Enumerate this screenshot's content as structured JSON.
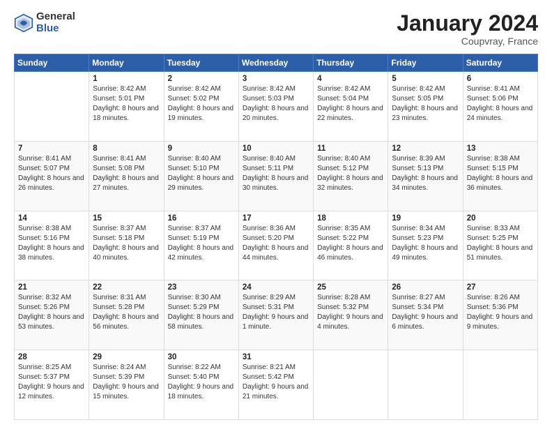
{
  "header": {
    "logo_general": "General",
    "logo_blue": "Blue",
    "title": "January 2024",
    "location": "Coupvray, France"
  },
  "calendar": {
    "days_of_week": [
      "Sunday",
      "Monday",
      "Tuesday",
      "Wednesday",
      "Thursday",
      "Friday",
      "Saturday"
    ],
    "weeks": [
      [
        {
          "day": "",
          "sunrise": "",
          "sunset": "",
          "daylight": ""
        },
        {
          "day": "1",
          "sunrise": "Sunrise: 8:42 AM",
          "sunset": "Sunset: 5:01 PM",
          "daylight": "Daylight: 8 hours and 18 minutes."
        },
        {
          "day": "2",
          "sunrise": "Sunrise: 8:42 AM",
          "sunset": "Sunset: 5:02 PM",
          "daylight": "Daylight: 8 hours and 19 minutes."
        },
        {
          "day": "3",
          "sunrise": "Sunrise: 8:42 AM",
          "sunset": "Sunset: 5:03 PM",
          "daylight": "Daylight: 8 hours and 20 minutes."
        },
        {
          "day": "4",
          "sunrise": "Sunrise: 8:42 AM",
          "sunset": "Sunset: 5:04 PM",
          "daylight": "Daylight: 8 hours and 22 minutes."
        },
        {
          "day": "5",
          "sunrise": "Sunrise: 8:42 AM",
          "sunset": "Sunset: 5:05 PM",
          "daylight": "Daylight: 8 hours and 23 minutes."
        },
        {
          "day": "6",
          "sunrise": "Sunrise: 8:41 AM",
          "sunset": "Sunset: 5:06 PM",
          "daylight": "Daylight: 8 hours and 24 minutes."
        }
      ],
      [
        {
          "day": "7",
          "sunrise": "Sunrise: 8:41 AM",
          "sunset": "Sunset: 5:07 PM",
          "daylight": "Daylight: 8 hours and 26 minutes."
        },
        {
          "day": "8",
          "sunrise": "Sunrise: 8:41 AM",
          "sunset": "Sunset: 5:08 PM",
          "daylight": "Daylight: 8 hours and 27 minutes."
        },
        {
          "day": "9",
          "sunrise": "Sunrise: 8:40 AM",
          "sunset": "Sunset: 5:10 PM",
          "daylight": "Daylight: 8 hours and 29 minutes."
        },
        {
          "day": "10",
          "sunrise": "Sunrise: 8:40 AM",
          "sunset": "Sunset: 5:11 PM",
          "daylight": "Daylight: 8 hours and 30 minutes."
        },
        {
          "day": "11",
          "sunrise": "Sunrise: 8:40 AM",
          "sunset": "Sunset: 5:12 PM",
          "daylight": "Daylight: 8 hours and 32 minutes."
        },
        {
          "day": "12",
          "sunrise": "Sunrise: 8:39 AM",
          "sunset": "Sunset: 5:13 PM",
          "daylight": "Daylight: 8 hours and 34 minutes."
        },
        {
          "day": "13",
          "sunrise": "Sunrise: 8:38 AM",
          "sunset": "Sunset: 5:15 PM",
          "daylight": "Daylight: 8 hours and 36 minutes."
        }
      ],
      [
        {
          "day": "14",
          "sunrise": "Sunrise: 8:38 AM",
          "sunset": "Sunset: 5:16 PM",
          "daylight": "Daylight: 8 hours and 38 minutes."
        },
        {
          "day": "15",
          "sunrise": "Sunrise: 8:37 AM",
          "sunset": "Sunset: 5:18 PM",
          "daylight": "Daylight: 8 hours and 40 minutes."
        },
        {
          "day": "16",
          "sunrise": "Sunrise: 8:37 AM",
          "sunset": "Sunset: 5:19 PM",
          "daylight": "Daylight: 8 hours and 42 minutes."
        },
        {
          "day": "17",
          "sunrise": "Sunrise: 8:36 AM",
          "sunset": "Sunset: 5:20 PM",
          "daylight": "Daylight: 8 hours and 44 minutes."
        },
        {
          "day": "18",
          "sunrise": "Sunrise: 8:35 AM",
          "sunset": "Sunset: 5:22 PM",
          "daylight": "Daylight: 8 hours and 46 minutes."
        },
        {
          "day": "19",
          "sunrise": "Sunrise: 8:34 AM",
          "sunset": "Sunset: 5:23 PM",
          "daylight": "Daylight: 8 hours and 49 minutes."
        },
        {
          "day": "20",
          "sunrise": "Sunrise: 8:33 AM",
          "sunset": "Sunset: 5:25 PM",
          "daylight": "Daylight: 8 hours and 51 minutes."
        }
      ],
      [
        {
          "day": "21",
          "sunrise": "Sunrise: 8:32 AM",
          "sunset": "Sunset: 5:26 PM",
          "daylight": "Daylight: 8 hours and 53 minutes."
        },
        {
          "day": "22",
          "sunrise": "Sunrise: 8:31 AM",
          "sunset": "Sunset: 5:28 PM",
          "daylight": "Daylight: 8 hours and 56 minutes."
        },
        {
          "day": "23",
          "sunrise": "Sunrise: 8:30 AM",
          "sunset": "Sunset: 5:29 PM",
          "daylight": "Daylight: 8 hours and 58 minutes."
        },
        {
          "day": "24",
          "sunrise": "Sunrise: 8:29 AM",
          "sunset": "Sunset: 5:31 PM",
          "daylight": "Daylight: 9 hours and 1 minute."
        },
        {
          "day": "25",
          "sunrise": "Sunrise: 8:28 AM",
          "sunset": "Sunset: 5:32 PM",
          "daylight": "Daylight: 9 hours and 4 minutes."
        },
        {
          "day": "26",
          "sunrise": "Sunrise: 8:27 AM",
          "sunset": "Sunset: 5:34 PM",
          "daylight": "Daylight: 9 hours and 6 minutes."
        },
        {
          "day": "27",
          "sunrise": "Sunrise: 8:26 AM",
          "sunset": "Sunset: 5:36 PM",
          "daylight": "Daylight: 9 hours and 9 minutes."
        }
      ],
      [
        {
          "day": "28",
          "sunrise": "Sunrise: 8:25 AM",
          "sunset": "Sunset: 5:37 PM",
          "daylight": "Daylight: 9 hours and 12 minutes."
        },
        {
          "day": "29",
          "sunrise": "Sunrise: 8:24 AM",
          "sunset": "Sunset: 5:39 PM",
          "daylight": "Daylight: 9 hours and 15 minutes."
        },
        {
          "day": "30",
          "sunrise": "Sunrise: 8:22 AM",
          "sunset": "Sunset: 5:40 PM",
          "daylight": "Daylight: 9 hours and 18 minutes."
        },
        {
          "day": "31",
          "sunrise": "Sunrise: 8:21 AM",
          "sunset": "Sunset: 5:42 PM",
          "daylight": "Daylight: 9 hours and 21 minutes."
        },
        {
          "day": "",
          "sunrise": "",
          "sunset": "",
          "daylight": ""
        },
        {
          "day": "",
          "sunrise": "",
          "sunset": "",
          "daylight": ""
        },
        {
          "day": "",
          "sunrise": "",
          "sunset": "",
          "daylight": ""
        }
      ]
    ]
  }
}
